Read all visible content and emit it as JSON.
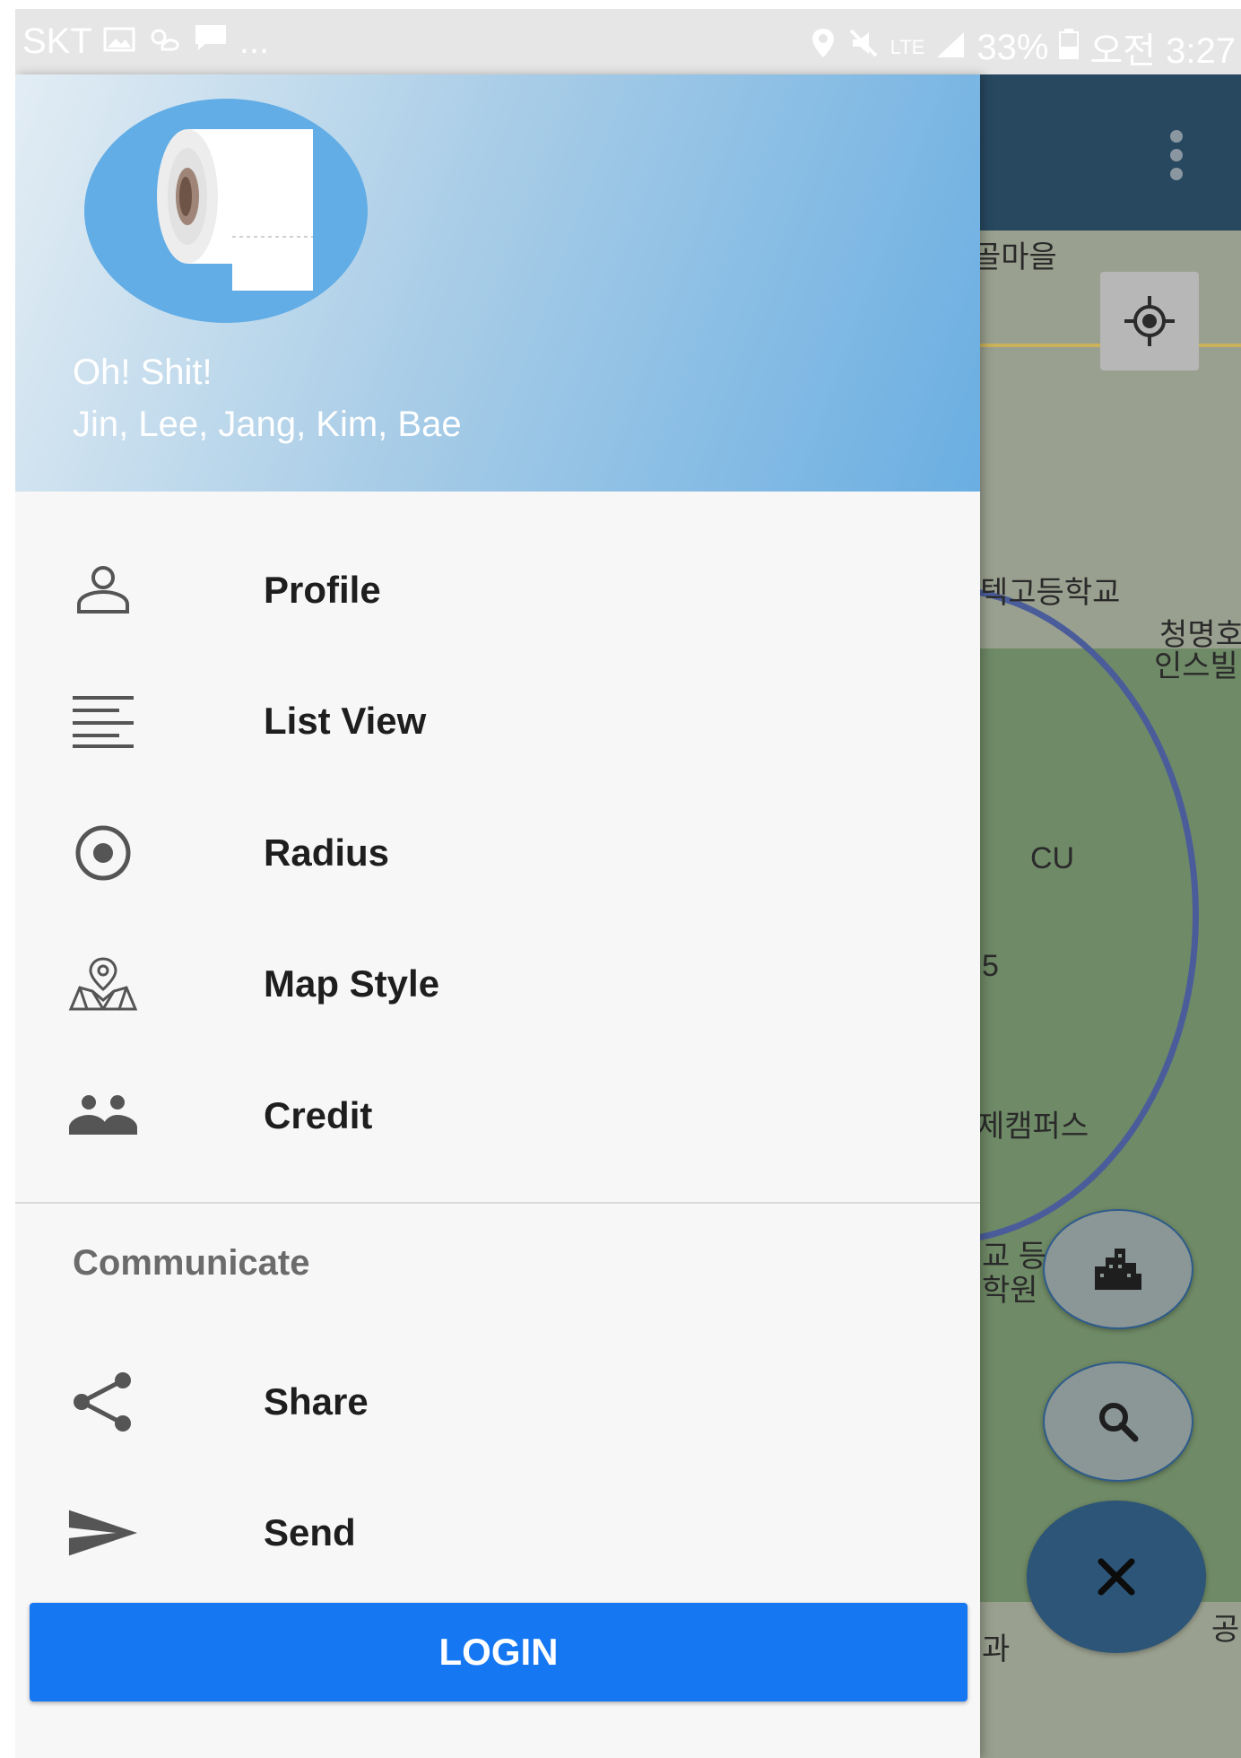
{
  "status_bar": {
    "carrier": "SKT",
    "more": "...",
    "network": "LTE",
    "battery": "33%",
    "time": "오전 3:27"
  },
  "drawer": {
    "app_name": "Oh! Shit!",
    "members": "Jin, Lee, Jang, Kim, Bae",
    "items": [
      {
        "label": "Profile",
        "icon": "person-icon"
      },
      {
        "label": "List View",
        "icon": "list-icon"
      },
      {
        "label": "Radius",
        "icon": "radio-target-icon"
      },
      {
        "label": "Map Style",
        "icon": "map-pin-icon"
      },
      {
        "label": "Credit",
        "icon": "group-icon"
      }
    ],
    "section_title": "Communicate",
    "communicate_items": [
      {
        "label": "Share",
        "icon": "share-icon"
      },
      {
        "label": "Send",
        "icon": "send-icon"
      }
    ],
    "login_label": "LOGIN"
  },
  "map": {
    "labels": [
      "골마을",
      "텍고등학교",
      "청명호",
      "인스빌",
      "CU",
      "5",
      "제캠퍼스",
      "교 등",
      "학원",
      "과",
      "공"
    ]
  },
  "colors": {
    "login_button": "#1677f2",
    "map_bar": "#27485f",
    "fab_close": "#2c5578",
    "avatar_bg": "#62ade6"
  }
}
